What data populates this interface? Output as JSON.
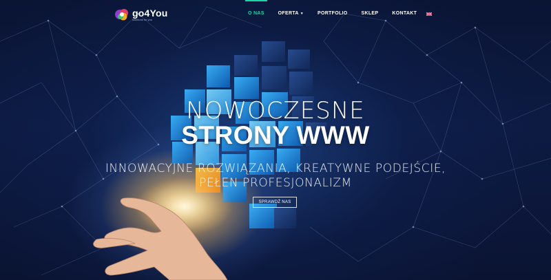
{
  "brand": {
    "name": "go4You",
    "tagline": "solutions for you",
    "colors": {
      "accent": "#18d6a8",
      "background": "#0b1430"
    }
  },
  "nav": {
    "items": [
      {
        "label": "O NAS",
        "active": true
      },
      {
        "label": "OFERTA",
        "dropdown": true
      },
      {
        "label": "PORTFOLIO"
      },
      {
        "label": "SKLEP"
      },
      {
        "label": "KONTAKT"
      }
    ],
    "language_flag": "english-flag-icon"
  },
  "hero": {
    "title_line1": "NOWOCZESNE",
    "title_line2": "STRONY WWW",
    "subtitle_line1": "INNOWACYJNE ROZWIĄZANIA, KREATYWNE PODEJŚCIE,",
    "subtitle_line2": "PEŁEN PROFESJONALIZM",
    "cta_label": "SPRAWDŹ NAS"
  }
}
